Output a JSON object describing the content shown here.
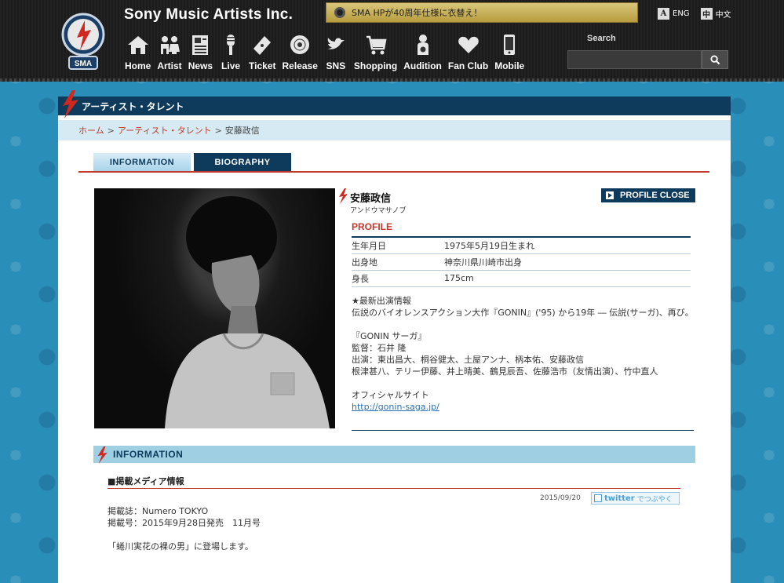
{
  "header": {
    "site_title": "Sony Music Artists Inc.",
    "logo_text": "SMA",
    "announcement": "SMA HPが40周年仕様に衣替え！",
    "lang": [
      {
        "glyph": "A",
        "label": "ENG"
      },
      {
        "glyph": "中",
        "label": "中文"
      }
    ],
    "nav": [
      {
        "label": "Home",
        "icon": "home-icon"
      },
      {
        "label": "Artist",
        "icon": "artist-icon"
      },
      {
        "label": "News",
        "icon": "news-icon"
      },
      {
        "label": "Live",
        "icon": "microphone-icon"
      },
      {
        "label": "Ticket",
        "icon": "ticket-icon"
      },
      {
        "label": "Release",
        "icon": "disc-icon"
      },
      {
        "label": "SNS",
        "icon": "twitter-bird-icon"
      },
      {
        "label": "Shopping",
        "icon": "cart-icon"
      },
      {
        "label": "Audition",
        "icon": "person-icon"
      },
      {
        "label": "Fan Club",
        "icon": "heart-icon"
      },
      {
        "label": "Mobile",
        "icon": "phone-icon"
      }
    ],
    "search_label": "Search",
    "search_placeholder": ""
  },
  "section_title": "アーティスト・タレント",
  "breadcrumb": {
    "home": "ホーム",
    "section": "アーティスト・タレント",
    "current": "安藤政信",
    "sep": ">"
  },
  "tabs": {
    "info": "INFORMATION",
    "bio": "BIOGRAPHY"
  },
  "artist": {
    "name": "安藤政信",
    "kana": "アンドウマサノブ",
    "profile_close": "PROFILE CLOSE",
    "profile_heading": "PROFILE",
    "profile_rows": [
      {
        "key": "生年月日",
        "value": "1975年5月19日生まれ"
      },
      {
        "key": "出身地",
        "value": "神奈川県川崎市出身"
      },
      {
        "key": "身長",
        "value": "175cm"
      }
    ],
    "news_lines": [
      "★最新出演情報",
      "伝説のバイオレンスアクション大作『GONIN』('95) から19年 ― 伝説(サーガ)、再び。",
      "",
      "『GONIN サーガ』",
      "監督：石井 隆",
      "出演：東出昌大、桐谷健太、土屋アンナ、柄本佑、安藤政信",
      "根津甚八、テリー伊藤、井上晴美、鶴見辰吾、佐藤浩市（友情出演）、竹中直人",
      "",
      "オフィシャルサイト"
    ],
    "official_link": "http://gonin-saga.jp/"
  },
  "information": {
    "heading": "INFORMATION",
    "media_title": "■掲載メディア情報",
    "date": "2015/09/20",
    "tweet_label": "twitter",
    "tweet_sub": "でつぶやく",
    "body_lines": [
      "掲載誌：Numero TOKYO",
      "掲載号：2015年9月28日発売　11月号",
      "",
      "「蜷川実花の裸の男」に登場します。"
    ]
  },
  "colors": {
    "navy": "#0e3a5c",
    "accent_red": "#c0392b",
    "light_blue": "#9fcfe2",
    "gold": "#c9b15a"
  }
}
